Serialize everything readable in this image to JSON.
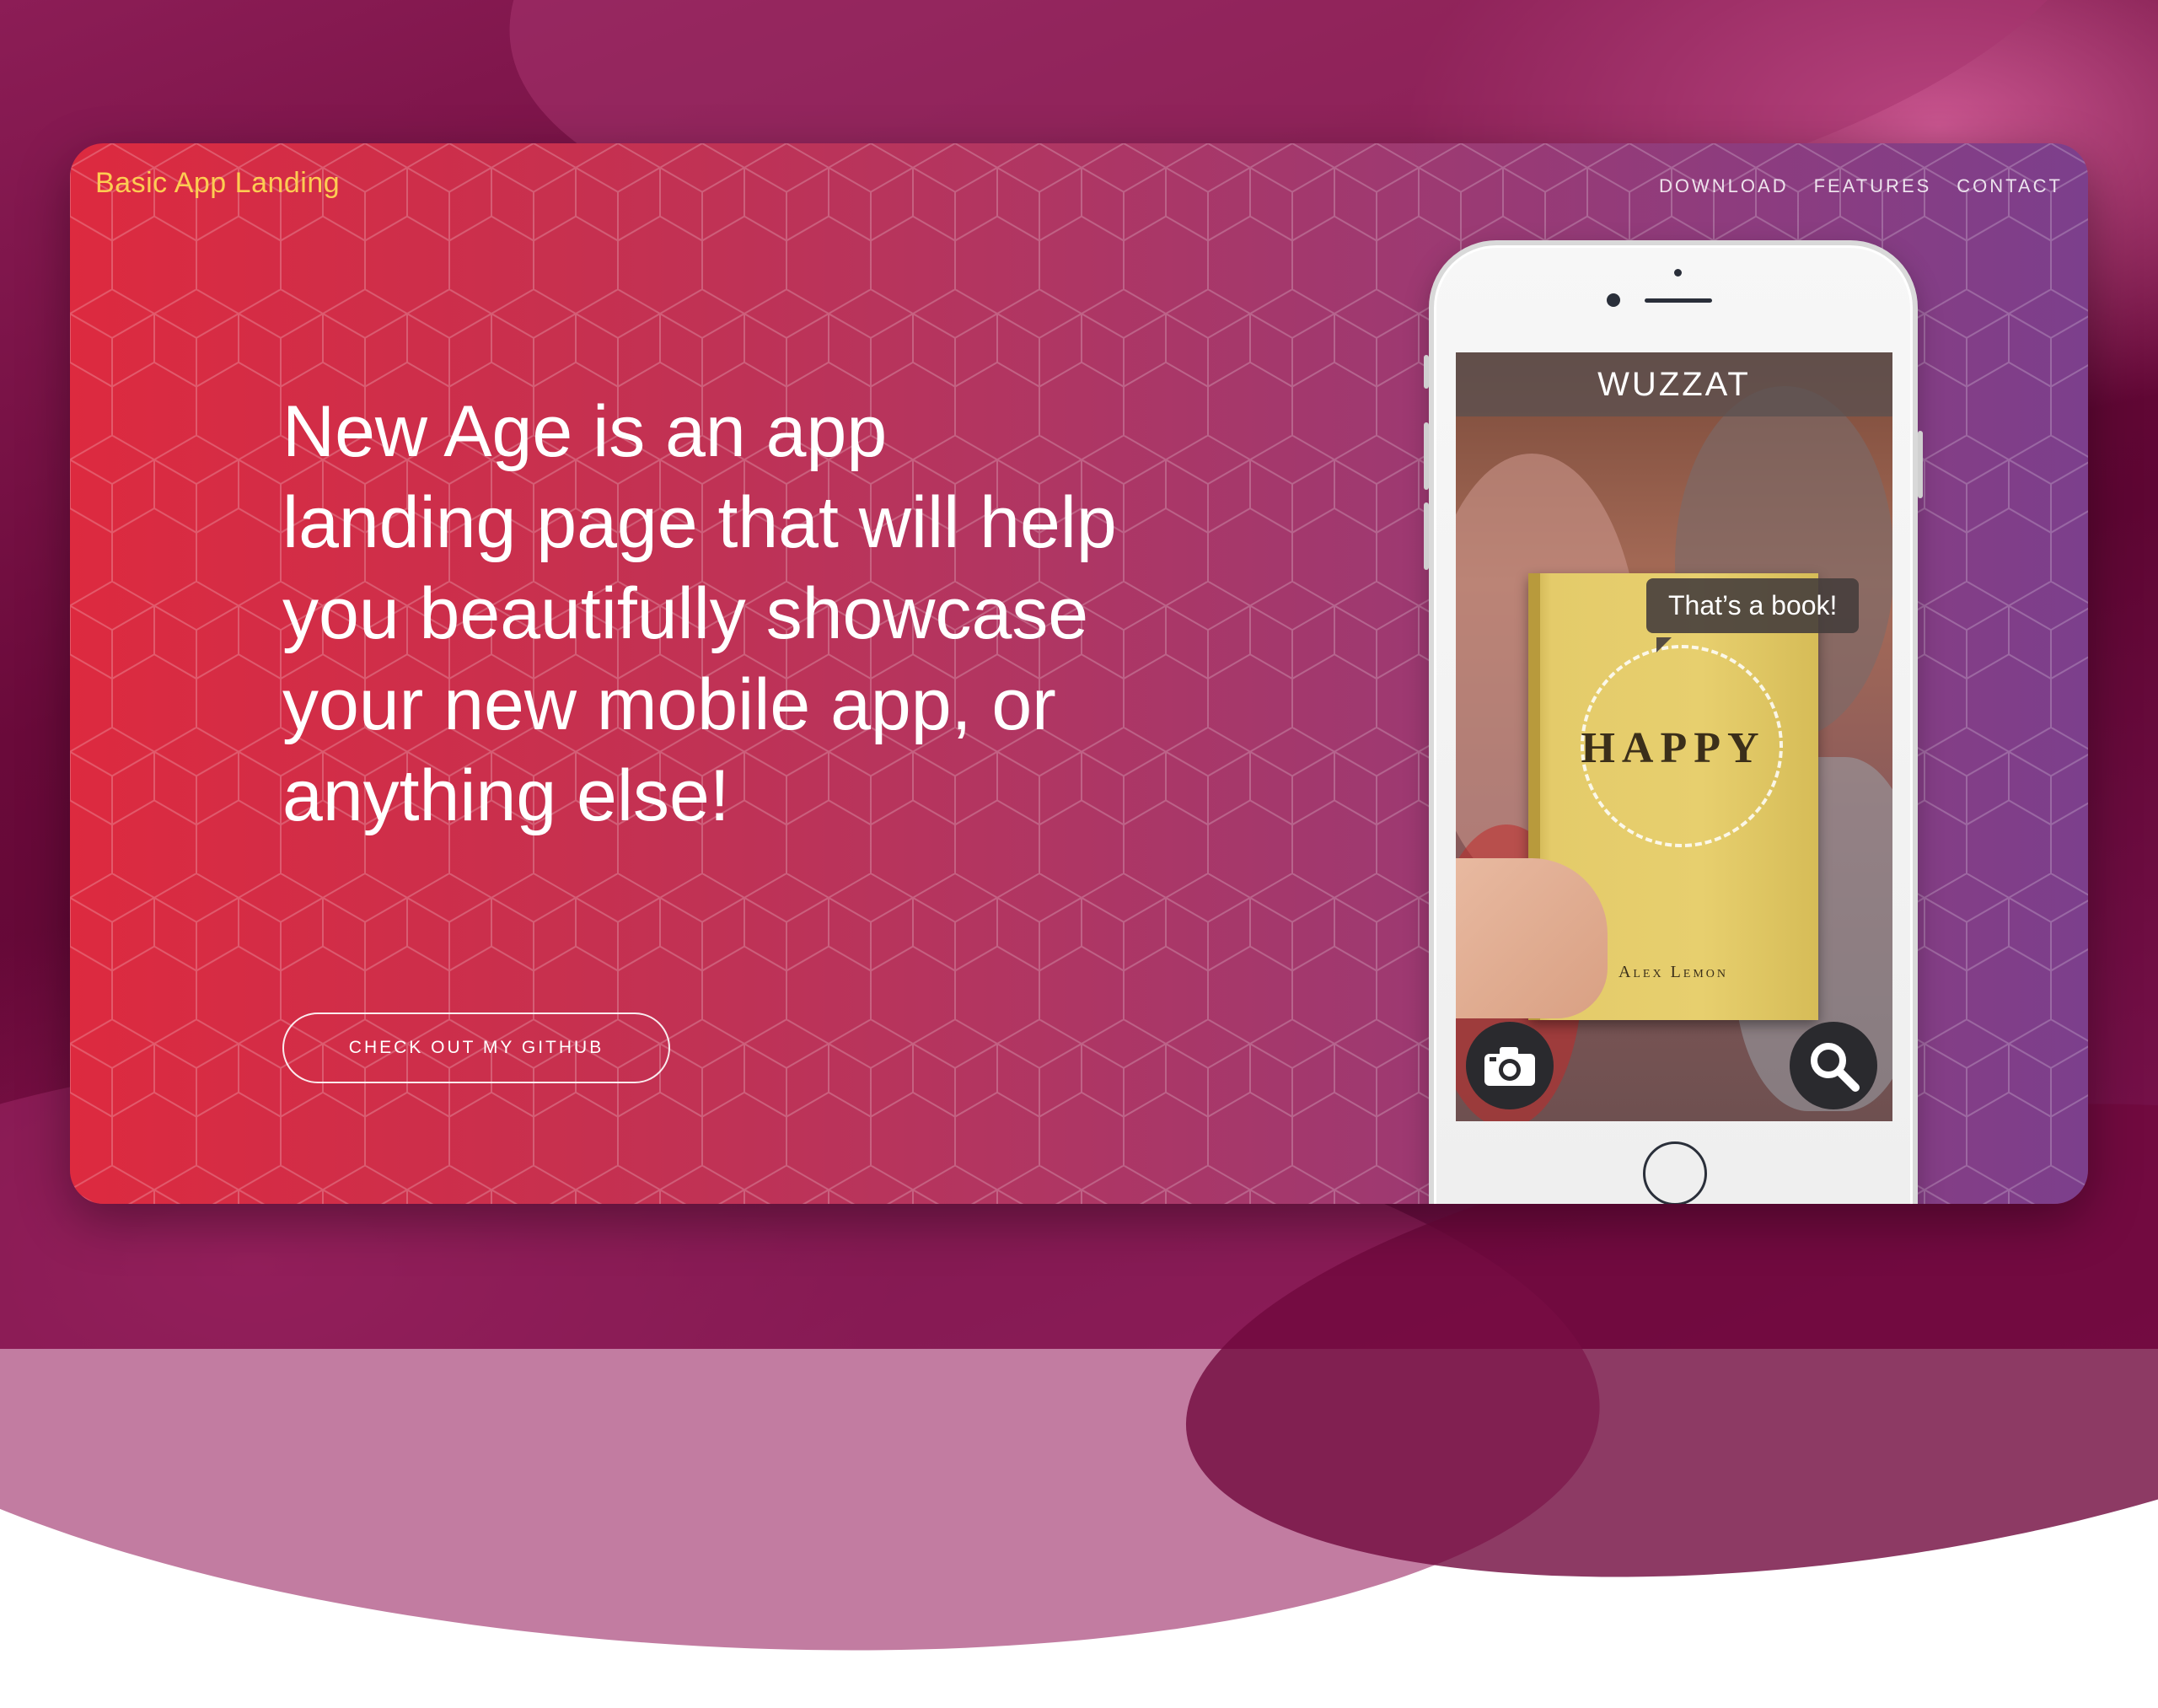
{
  "site": {
    "brand": "Basic App Landing",
    "nav": [
      "DOWNLOAD",
      "FEATURES",
      "CONTACT"
    ]
  },
  "hero": {
    "headline": "New Age is an app landing page that will help you beautifully showcase your new mobile app, or anything else!",
    "cta_label": "CHECK OUT MY GITHUB"
  },
  "phone_screen": {
    "app_title": "WUZZAT",
    "bubble_text": "That’s a book!",
    "book_title": "HAPPY",
    "book_author": "Alex Lemon",
    "buttons": [
      "camera-icon",
      "search-icon"
    ]
  },
  "colors": {
    "brand": "#fdcc52",
    "gradient_start": "#dd2a3f",
    "gradient_end": "#7c3f8c"
  }
}
